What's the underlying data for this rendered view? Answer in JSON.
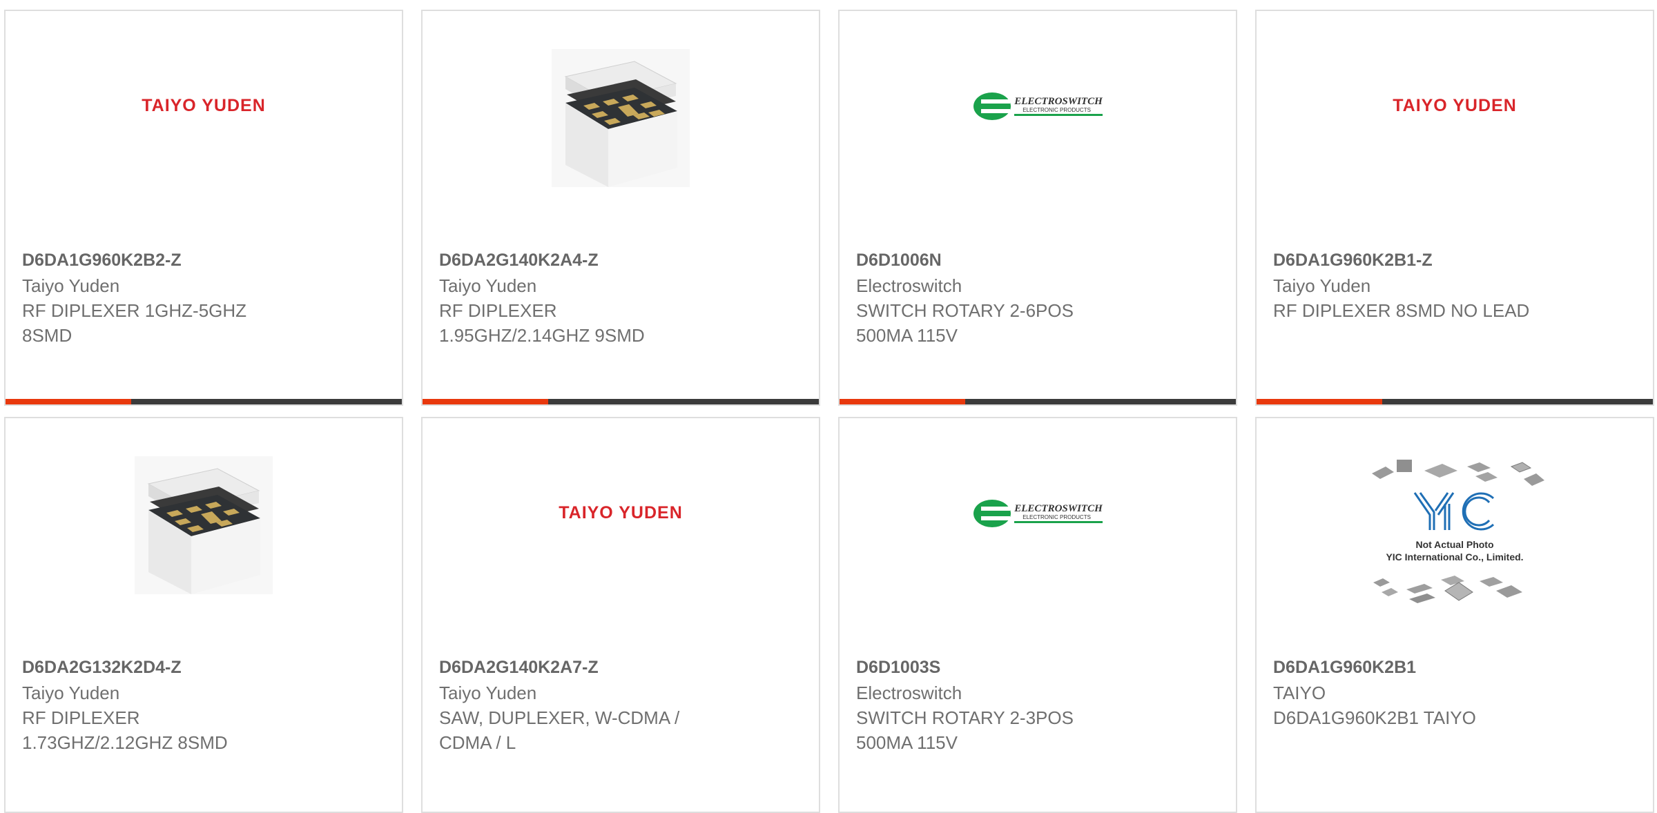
{
  "products": [
    {
      "part_number": "D6DA1G960K2B2-Z",
      "manufacturer": "Taiyo Yuden",
      "description": "RF DIPLEXER 1GHZ-5GHZ 8SMD",
      "image": "taiyo-yuden-logo",
      "logo_text": "TAIYO YUDEN"
    },
    {
      "part_number": "D6DA2G140K2A4-Z",
      "manufacturer": "Taiyo Yuden",
      "description": "RF DIPLEXER 1.95GHZ/2.14GHZ 9SMD",
      "image": "smd-chip-photo"
    },
    {
      "part_number": "D6D1006N",
      "manufacturer": "Electroswitch",
      "description": "SWITCH ROTARY 2-6POS 500MA 115V",
      "image": "electroswitch-logo",
      "logo_text": "ELECTROSWITCH",
      "logo_subtext": "ELECTRONIC PRODUCTS"
    },
    {
      "part_number": "D6DA1G960K2B1-Z",
      "manufacturer": "Taiyo Yuden",
      "description": "RF DIPLEXER 8SMD NO LEAD",
      "image": "taiyo-yuden-logo",
      "logo_text": "TAIYO YUDEN"
    },
    {
      "part_number": "D6DA2G132K2D4-Z",
      "manufacturer": "Taiyo Yuden",
      "description": "RF DIPLEXER 1.73GHZ/2.12GHZ 8SMD",
      "image": "smd-chip-photo"
    },
    {
      "part_number": "D6DA2G140K2A7-Z",
      "manufacturer": "Taiyo Yuden",
      "description": "SAW, DUPLEXER, W-CDMA / CDMA / L",
      "image": "taiyo-yuden-logo",
      "logo_text": "TAIYO YUDEN"
    },
    {
      "part_number": "D6D1003S",
      "manufacturer": "Electroswitch",
      "description": "SWITCH ROTARY 2-3POS 500MA 115V",
      "image": "electroswitch-logo",
      "logo_text": "ELECTROSWITCH",
      "logo_subtext": "ELECTRONIC PRODUCTS"
    },
    {
      "part_number": "D6DA1G960K2B1",
      "manufacturer": "TAIYO",
      "description": "D6DA1G960K2B1 TAIYO",
      "image": "yic-placeholder",
      "logo_text": "YIC",
      "placeholder_line1": "Not Actual Photo",
      "placeholder_line2": "YIC International Co., Limited."
    }
  ],
  "colors": {
    "accent_bar": "#e8380d",
    "dark_bar": "#3b3b3b",
    "taiyo_red": "#d9252a",
    "electroswitch_green": "#1aa24b",
    "yic_blue": "#1f6fb5"
  }
}
